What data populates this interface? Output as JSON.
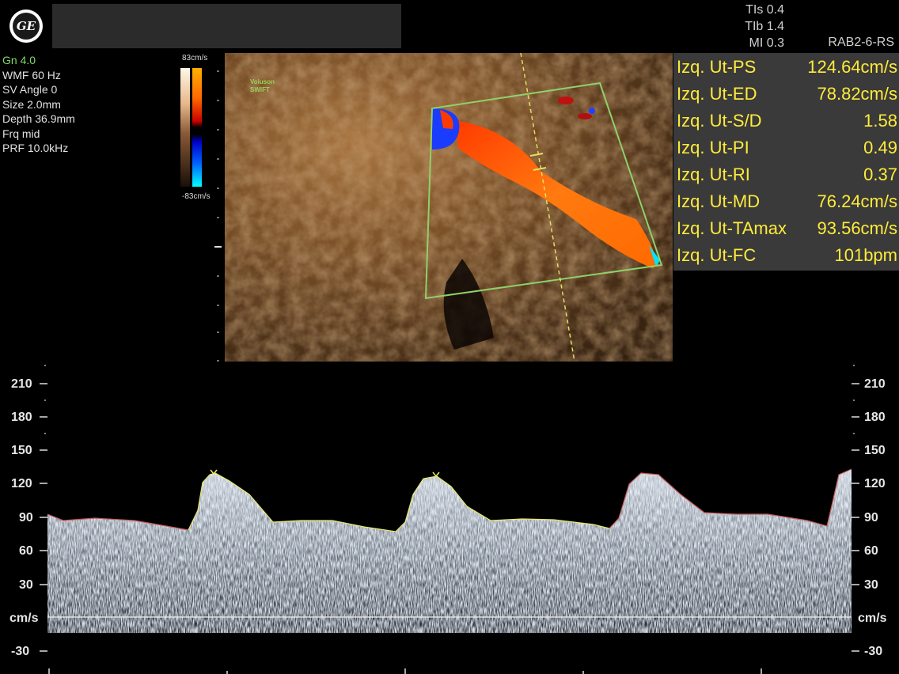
{
  "header": {
    "logo_text": "GE",
    "tis": "TIs 0.4",
    "tib": "TIb 1.4",
    "mi": "MI 0.3",
    "probe": "RAB2-6-RS"
  },
  "params": {
    "gain": "Gn  4.0",
    "wmf": "WMF 60 Hz",
    "sv_angle": "SV Angle  0",
    "size": "Size  2.0mm",
    "depth": "Depth 36.9mm",
    "frq": "Frq mid",
    "prf": "PRF 10.0kHz"
  },
  "colorscale": {
    "top": "83cm/s",
    "bottom": "-83cm/s"
  },
  "image": {
    "brand_line1": "Voluson",
    "brand_line2": "SWIFT"
  },
  "measurements": [
    {
      "label": "Izq. Ut-PS",
      "value": "124.64cm/s"
    },
    {
      "label": "Izq. Ut-ED",
      "value": "78.82cm/s"
    },
    {
      "label": "Izq. Ut-S/D",
      "value": "1.58"
    },
    {
      "label": "Izq. Ut-PI",
      "value": "0.49"
    },
    {
      "label": "Izq. Ut-RI",
      "value": "0.37"
    },
    {
      "label": "Izq. Ut-MD",
      "value": "76.24cm/s"
    },
    {
      "label": "Izq. Ut-TAmax",
      "value": "93.56cm/s"
    },
    {
      "label": "Izq. Ut-FC",
      "value": "101bpm"
    }
  ],
  "spectrum": {
    "y_ticks": [
      "210",
      "180",
      "150",
      "120",
      "90",
      "60",
      "30",
      "cm/s",
      "-30"
    ],
    "unit": "cm/s"
  },
  "colors": {
    "measurement_text": "#ffeb3b",
    "envelope_traced": "#e8e86a",
    "envelope_auto": "#c85a5a",
    "roi_box": "#8fd16a"
  }
}
